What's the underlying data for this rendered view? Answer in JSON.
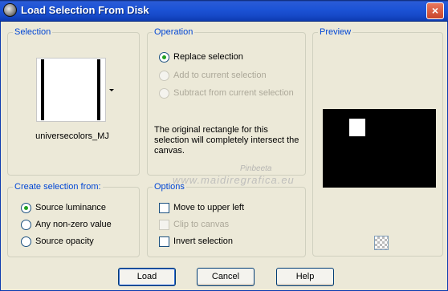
{
  "window": {
    "title": "Load Selection From Disk",
    "close_label": "×"
  },
  "selection": {
    "group_label": "Selection",
    "swatch_name": "universecolors_MJ"
  },
  "operation": {
    "group_label": "Operation",
    "options": [
      "Replace selection",
      "Add to current selection",
      "Subtract from current selection"
    ],
    "note": "The original rectangle for this selection will completely intersect the canvas."
  },
  "preview": {
    "group_label": "Preview"
  },
  "create_from": {
    "group_label": "Create selection from:",
    "options": [
      "Source luminance",
      "Any non-zero value",
      "Source opacity"
    ]
  },
  "options": {
    "group_label": "Options",
    "items": [
      "Move to upper left",
      "Clip to canvas",
      "Invert selection"
    ]
  },
  "watermark": {
    "text": "www.maidiregrafica.eu",
    "sub": "Pinbeeta"
  },
  "buttons": {
    "load": "Load",
    "cancel": "Cancel",
    "help": "Help"
  }
}
